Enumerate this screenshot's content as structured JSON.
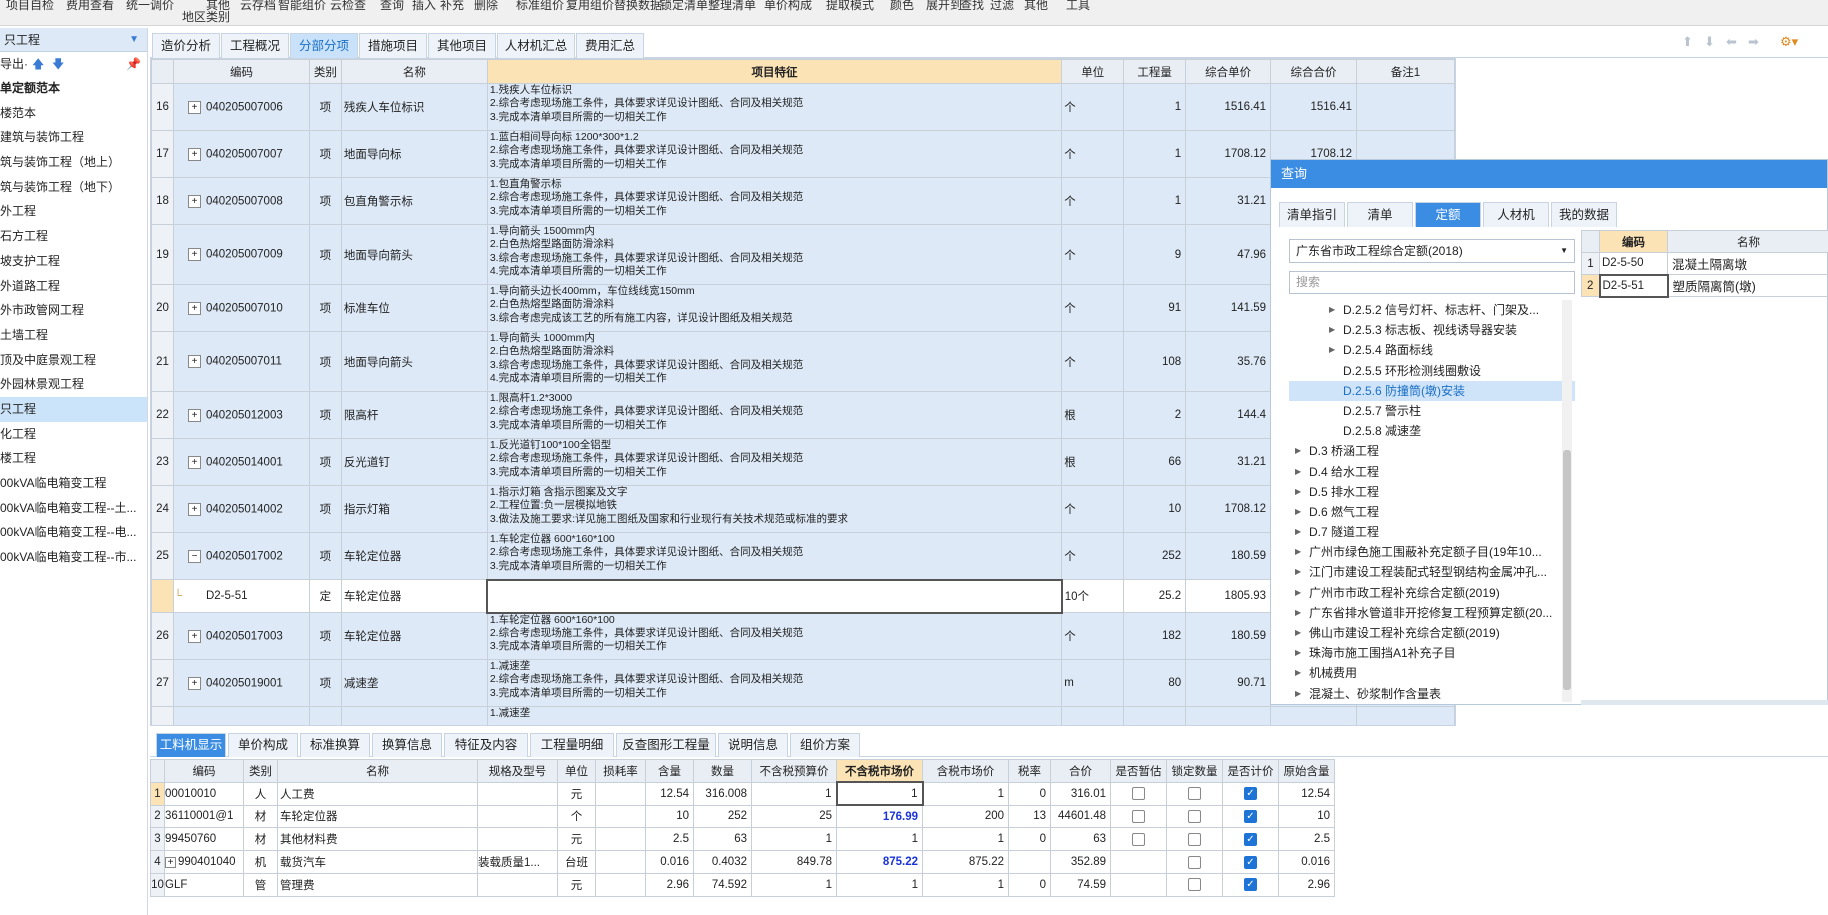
{
  "ribbon": {
    "row1": [
      "项目自检",
      "费用查看",
      "统一",
      "调价",
      "",
      "其他",
      "",
      "云存档",
      "智能组价",
      "云检查",
      "查询",
      "插入",
      "补充",
      "删除",
      "标准组价",
      "复用组价",
      "替换数据",
      "锁定清单",
      "整理清单",
      "单价构成",
      "提取模式",
      "颜色",
      "展开到",
      "查找",
      "过滤",
      "其他",
      "工具"
    ],
    "row2": [
      "地区类别"
    ]
  },
  "left": {
    "header": "只工程",
    "export_label": "导出·",
    "items": [
      {
        "label": "单定额范本",
        "bold": true
      },
      {
        "label": "楼范本"
      },
      {
        "label": "建筑与装饰工程"
      },
      {
        "label": "筑与装饰工程（地上）"
      },
      {
        "label": "筑与装饰工程（地下）"
      },
      {
        "label": "外工程"
      },
      {
        "label": "石方工程"
      },
      {
        "label": "坡支护工程"
      },
      {
        "label": "外道路工程"
      },
      {
        "label": "外市政管网工程"
      },
      {
        "label": "土墙工程"
      },
      {
        "label": "顶及中庭景观工程"
      },
      {
        "label": "外园林景观工程"
      },
      {
        "label": "只工程",
        "sel": true
      },
      {
        "label": "化工程"
      },
      {
        "label": "楼工程"
      },
      {
        "label": "00kVA临电箱变工程"
      },
      {
        "label": "00kVA临电箱变工程--土..."
      },
      {
        "label": "00kVA临电箱变工程--电..."
      },
      {
        "label": "00kVA临电箱变工程--市..."
      }
    ]
  },
  "tabs": [
    "造价分析",
    "工程概况",
    "分部分项",
    "措施项目",
    "其他项目",
    "人材机汇总",
    "费用汇总"
  ],
  "active_tab": "分部分项",
  "grid": {
    "headers": [
      "",
      "编码",
      "类别",
      "名称",
      "项目特征",
      "单位",
      "工程量",
      "综合单价",
      "综合合价",
      "备注1"
    ],
    "rows": [
      {
        "idx": "16",
        "code": "040205007006",
        "type": "项",
        "name": "残疾人车位标识",
        "feat": [
          "1.残疾人车位标识",
          "2.综合考虑现场施工条件，具体要求详见设计图纸、合同及相关规范",
          "3.完成本清单项目所需的一切相关工作"
        ],
        "unit": "个",
        "qty": "1",
        "price": "1516.41",
        "total": "1516.41"
      },
      {
        "idx": "17",
        "code": "040205007007",
        "type": "项",
        "name": "地面导向标",
        "feat": [
          "1.蓝白相间导向标 1200*300*1.2",
          "2.综合考虑现场施工条件，具体要求详见设计图纸、合同及相关规范",
          "3.完成本清单项目所需的一切相关工作"
        ],
        "unit": "个",
        "qty": "1",
        "price": "1708.12",
        "total": "1708.12"
      },
      {
        "idx": "18",
        "code": "040205007008",
        "type": "项",
        "name": "包直角警示标",
        "feat": [
          "1.包直角警示标",
          "2.综合考虑现场施工条件，具体要求详见设计图纸、合同及相关规范",
          "3.完成本清单项目所需的一切相关工作"
        ],
        "unit": "个",
        "qty": "1",
        "price": "31.21",
        "total": ""
      },
      {
        "idx": "19",
        "code": "040205007009",
        "type": "项",
        "name": "地面导向箭头",
        "feat": [
          "1.导向箭头 1500mm内",
          "2.白色热熔型路面防滑涂料",
          "3.综合考虑现场施工条件，具体要求详见设计图纸、合同及相关规范",
          "4.完成本清单项目所需的一切相关工作"
        ],
        "unit": "个",
        "qty": "9",
        "price": "47.96",
        "total": ""
      },
      {
        "idx": "20",
        "code": "040205007010",
        "type": "项",
        "name": "标准车位",
        "feat": [
          "1.导向箭头边长400mm，车位线线宽150mm",
          "2.白色热熔型路面防滑涂料",
          "3.综合考虑完成该工艺的所有施工内容，详见设计图纸及相关规范"
        ],
        "unit": "个",
        "qty": "91",
        "price": "141.59",
        "total": ""
      },
      {
        "idx": "21",
        "code": "040205007011",
        "type": "项",
        "name": "地面导向箭头",
        "feat": [
          "1.导向箭头 1000mm内",
          "2.白色热熔型路面防滑涂料",
          "3.综合考虑现场施工条件，具体要求详见设计图纸、合同及相关规范",
          "4.完成本清单项目所需的一切相关工作"
        ],
        "unit": "个",
        "qty": "108",
        "price": "35.76",
        "total": ""
      },
      {
        "idx": "22",
        "code": "040205012003",
        "type": "项",
        "name": "限高杆",
        "feat": [
          "1.限高杆1.2*3000",
          "2.综合考虑现场施工条件，具体要求详见设计图纸、合同及相关规范",
          "3.完成本清单项目所需的一切相关工作"
        ],
        "unit": "根",
        "qty": "2",
        "price": "144.4",
        "total": ""
      },
      {
        "idx": "23",
        "code": "040205014001",
        "type": "项",
        "name": "反光道钉",
        "feat": [
          "1.反光道钉100*100全铝型",
          "2.综合考虑现场施工条件，具体要求详见设计图纸、合同及相关规范",
          "3.完成本清单项目所需的一切相关工作"
        ],
        "unit": "根",
        "qty": "66",
        "price": "31.21",
        "total": ""
      },
      {
        "idx": "24",
        "code": "040205014002",
        "type": "项",
        "name": "指示灯箱",
        "feat": [
          "1.指示灯箱 含指示图案及文字",
          "2.工程位置:负一层模拟地铁",
          "3.做法及施工要求:详见施工图纸及国家和行业现行有关技术规范或标准的要求"
        ],
        "unit": "个",
        "qty": "10",
        "price": "1708.12",
        "total": ""
      },
      {
        "idx": "25",
        "code": "040205017002",
        "type": "项",
        "name": "车轮定位器",
        "feat": [
          "1.车轮定位器 600*160*100",
          "2.综合考虑现场施工条件，具体要求详见设计图纸、合同及相关规范",
          "3.完成本清单项目所需的一切相关工作"
        ],
        "unit": "个",
        "qty": "252",
        "price": "180.59",
        "total": "",
        "expanded": true
      },
      {
        "idx": "",
        "code": "D2-5-51",
        "type": "定",
        "name": "车轮定位器",
        "feat": [],
        "unit": "10个",
        "qty": "25.2",
        "price": "1805.93",
        "total": "",
        "sub": true
      },
      {
        "idx": "26",
        "code": "040205017003",
        "type": "项",
        "name": "车轮定位器",
        "feat": [
          "1.车轮定位器 600*160*100",
          "2.综合考虑现场施工条件，具体要求详见设计图纸、合同及相关规范",
          "3.完成本清单项目所需的一切相关工作"
        ],
        "unit": "个",
        "qty": "182",
        "price": "180.59",
        "total": ""
      },
      {
        "idx": "27",
        "code": "040205019001",
        "type": "项",
        "name": "减速垄",
        "feat": [
          "1.减速垄",
          "2.综合考虑现场施工条件，具体要求详见设计图纸、合同及相关规范",
          "3.完成本清单项目所需的一切相关工作"
        ],
        "unit": "m",
        "qty": "80",
        "price": "90.71",
        "total": ""
      },
      {
        "idx": "",
        "code": "",
        "type": "",
        "name": "",
        "feat": [
          "1.减速垄"
        ],
        "unit": "",
        "qty": "",
        "price": "",
        "total": ""
      }
    ]
  },
  "query": {
    "title": "查询",
    "tabs": [
      "清单指引",
      "清单",
      "定额",
      "人材机",
      "我的数据"
    ],
    "active_tab": "定额",
    "select_value": "广东省市政工程综合定额(2018)",
    "search_placeholder": "搜索",
    "tree": [
      {
        "label": "D.2.5.2 信号灯杆、标志杆、门架及...",
        "indent": 54,
        "tri": "▸"
      },
      {
        "label": "D.2.5.3 标志板、视线诱导器安装",
        "indent": 54,
        "tri": "▸"
      },
      {
        "label": "D.2.5.4 路面标线",
        "indent": 54,
        "tri": "▸"
      },
      {
        "label": "D.2.5.5 环形检测线圈敷设",
        "indent": 54,
        "tri": ""
      },
      {
        "label": "D.2.5.6 防撞筒(墩)安装",
        "indent": 54,
        "tri": "",
        "sel": true
      },
      {
        "label": "D.2.5.7 警示柱",
        "indent": 54,
        "tri": ""
      },
      {
        "label": "D.2.5.8 减速垄",
        "indent": 54,
        "tri": ""
      },
      {
        "label": "D.3 桥涵工程",
        "indent": 20,
        "tri": "▸"
      },
      {
        "label": "D.4 给水工程",
        "indent": 20,
        "tri": "▸"
      },
      {
        "label": "D.5 排水工程",
        "indent": 20,
        "tri": "▸"
      },
      {
        "label": "D.6 燃气工程",
        "indent": 20,
        "tri": "▸"
      },
      {
        "label": "D.7 隧道工程",
        "indent": 20,
        "tri": "▸"
      },
      {
        "label": "广州市绿色施工围蔽补充定额子目(19年10...",
        "indent": 20,
        "tri": "▸"
      },
      {
        "label": "江门市建设工程装配式轻型钢结构金属冲孔...",
        "indent": 20,
        "tri": "▸"
      },
      {
        "label": "广州市市政工程补充综合定额(2019)",
        "indent": 20,
        "tri": "▸"
      },
      {
        "label": "广东省排水管道非开挖修复工程预算定额(20...",
        "indent": 20,
        "tri": "▸"
      },
      {
        "label": "佛山市建设工程补充综合定额(2019)",
        "indent": 20,
        "tri": "▸"
      },
      {
        "label": "珠海市施工围挡A1补充子目",
        "indent": 20,
        "tri": "▸"
      },
      {
        "label": "机械费用",
        "indent": 20,
        "tri": "▸"
      },
      {
        "label": "混凝土、砂浆制作含量表",
        "indent": 20,
        "tri": "▸"
      }
    ],
    "result_headers": [
      "",
      "编码",
      "名称"
    ],
    "results": [
      {
        "idx": "1",
        "code": "D2-5-50",
        "name": "混凝土隔离墩"
      },
      {
        "idx": "2",
        "code": "D2-5-51",
        "name": "塑质隔离筒(墩)"
      }
    ]
  },
  "bottom_tabs": [
    "工料机显示",
    "单价构成",
    "标准换算",
    "换算信息",
    "特征及内容",
    "工程量明细",
    "反查图形工程量",
    "说明信息",
    "组价方案"
  ],
  "bottom_active": "工料机显示",
  "bottom": {
    "headers": [
      "",
      "编码",
      "类别",
      "名称",
      "规格及型号",
      "单位",
      "损耗率",
      "含量",
      "数量",
      "不含税预算价",
      "不含税市场价",
      "含税市场价",
      "税率",
      "合价",
      "是否暂估",
      "锁定数量",
      "是否计价",
      "原始含量"
    ],
    "rows": [
      {
        "idx": "1",
        "code": "00010010",
        "type": "人",
        "name": "人工费",
        "spec": "",
        "unit": "元",
        "loss": "",
        "content": "12.54",
        "qty": "316.008",
        "budget": "1",
        "market": "1",
        "taxmarket": "1",
        "tax": "0",
        "total": "316.01",
        "est": false,
        "lock": false,
        "priced": true,
        "orig": "12.54"
      },
      {
        "idx": "2",
        "code": "36110001@1",
        "type": "材",
        "name": "车轮定位器",
        "spec": "",
        "unit": "个",
        "loss": "",
        "content": "10",
        "qty": "252",
        "budget": "25",
        "market": "176.99",
        "taxmarket": "200",
        "tax": "13",
        "total": "44601.48",
        "est": false,
        "lock": false,
        "priced": true,
        "orig": "10",
        "blue": true
      },
      {
        "idx": "3",
        "code": "99450760",
        "type": "材",
        "name": "其他材料费",
        "spec": "",
        "unit": "元",
        "loss": "",
        "content": "2.5",
        "qty": "63",
        "budget": "1",
        "market": "1",
        "taxmarket": "1",
        "tax": "0",
        "total": "63",
        "est": false,
        "lock": false,
        "priced": true,
        "orig": "2.5"
      },
      {
        "idx": "4",
        "code": "990401040",
        "type": "机",
        "name": "载货汽车",
        "spec": "装载质量1...",
        "unit": "台班",
        "loss": "",
        "content": "0.016",
        "qty": "0.4032",
        "budget": "849.78",
        "market": "875.22",
        "taxmarket": "875.22",
        "tax": "",
        "total": "352.89",
        "est": null,
        "lock": false,
        "priced": true,
        "orig": "0.016",
        "blue": true,
        "plus": true
      },
      {
        "idx": "10",
        "code": "GLF",
        "type": "管",
        "name": "管理费",
        "spec": "",
        "unit": "元",
        "loss": "",
        "content": "2.96",
        "qty": "74.592",
        "budget": "1",
        "market": "1",
        "taxmarket": "1",
        "tax": "0",
        "total": "74.59",
        "est": null,
        "lock": false,
        "priced": true,
        "orig": "2.96"
      }
    ]
  }
}
